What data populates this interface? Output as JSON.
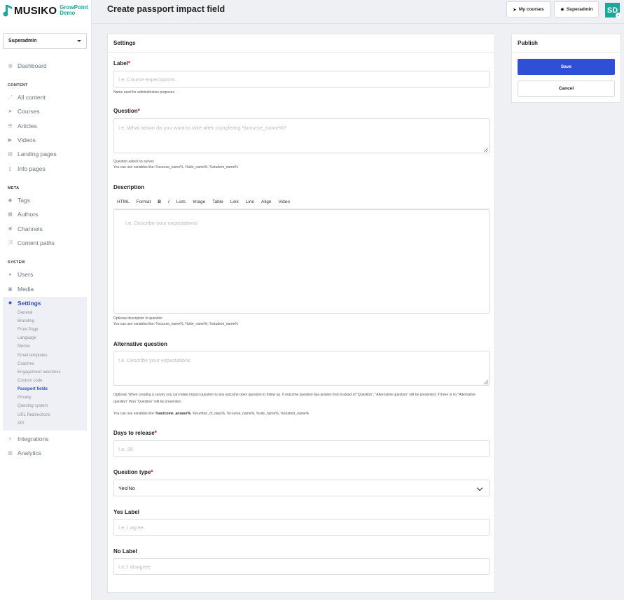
{
  "brand": {
    "name": "MUSIKO",
    "sub1": "GrowPoint",
    "sub2": "Demo",
    "accent": "#1aa89e"
  },
  "role_select": {
    "value": "Superadmin"
  },
  "nav": {
    "dashboard": "Dashboard",
    "content_heading": "CONTENT",
    "all_content": "All content",
    "courses": "Courses",
    "articles": "Articles",
    "videos": "Videos",
    "landing_pages": "Landing pages",
    "info_pages": "Info pages",
    "meta_heading": "META",
    "tags": "Tags",
    "authors": "Authors",
    "channels": "Channels",
    "content_paths": "Content paths",
    "system_heading": "SYSTEM",
    "users": "Users",
    "media": "Media",
    "settings": "Settings",
    "settings_sub": [
      "General",
      "Branding",
      "Front Page",
      "Language",
      "Menus",
      "Email templates",
      "Coaches",
      "Engagement outcomes",
      "Custom code",
      "Passport fields",
      "Privacy",
      "Queuing system",
      "URL Redirections",
      "API"
    ],
    "integrations": "Integrations",
    "analytics": "Analytics"
  },
  "header": {
    "title": "Create passport impact field",
    "my_courses": "My courses",
    "superadmin": "Superadmin",
    "avatar": "SD"
  },
  "settings": {
    "heading": "Settings",
    "label": {
      "label": "Label",
      "placeholder": "I.e. Course expectations",
      "help": "Name used for administrative purposes"
    },
    "question": {
      "label": "Question",
      "placeholder": "I.e. What action do you want to take after completing %course_name%?",
      "help1": "Question asked on survey",
      "help2": "You can use variables like: %course_name%, %site_name%, %student_name%"
    },
    "description": {
      "label": "Description",
      "toolbar": [
        "HTML",
        "Format",
        "B",
        "I",
        "Lists",
        "Image",
        "Table",
        "Link",
        "Line",
        "Align",
        "Video"
      ],
      "placeholder": "I.e. Describe your expectations",
      "help1": "Optional description to question",
      "help2": "You can use variables like: %course_name%, %site_name%, %student_name%"
    },
    "alt_question": {
      "label": "Alternative question",
      "placeholder": "I.e. Describe your expectations",
      "help1": "Optional. When creating a survey you can relate impact question to any outcome open question to follow up. If outcome question has answer than instead of \"Question\", \"Alternative question\" will be presented. If there is no \"Alternative question\" than \"Question\" will be presented.",
      "help2_prefix": "You can use variables like: ",
      "help2_bold": "%outcome_answer%",
      "help2_rest": ", %number_of_days%, %course_name%, %site_name%, %student_name%"
    },
    "days": {
      "label": "Days to release",
      "placeholder": "I.e. 30"
    },
    "qtype": {
      "label": "Question type",
      "value": "Yes/No"
    },
    "yes_label": {
      "label": "Yes Label",
      "placeholder": "I.e. I agree"
    },
    "no_label": {
      "label": "No Label",
      "placeholder": "I.e. I disagree"
    }
  },
  "publish": {
    "heading": "Publish",
    "save": "Save",
    "cancel": "Cancel",
    "save_color": "#2f4fd6"
  }
}
